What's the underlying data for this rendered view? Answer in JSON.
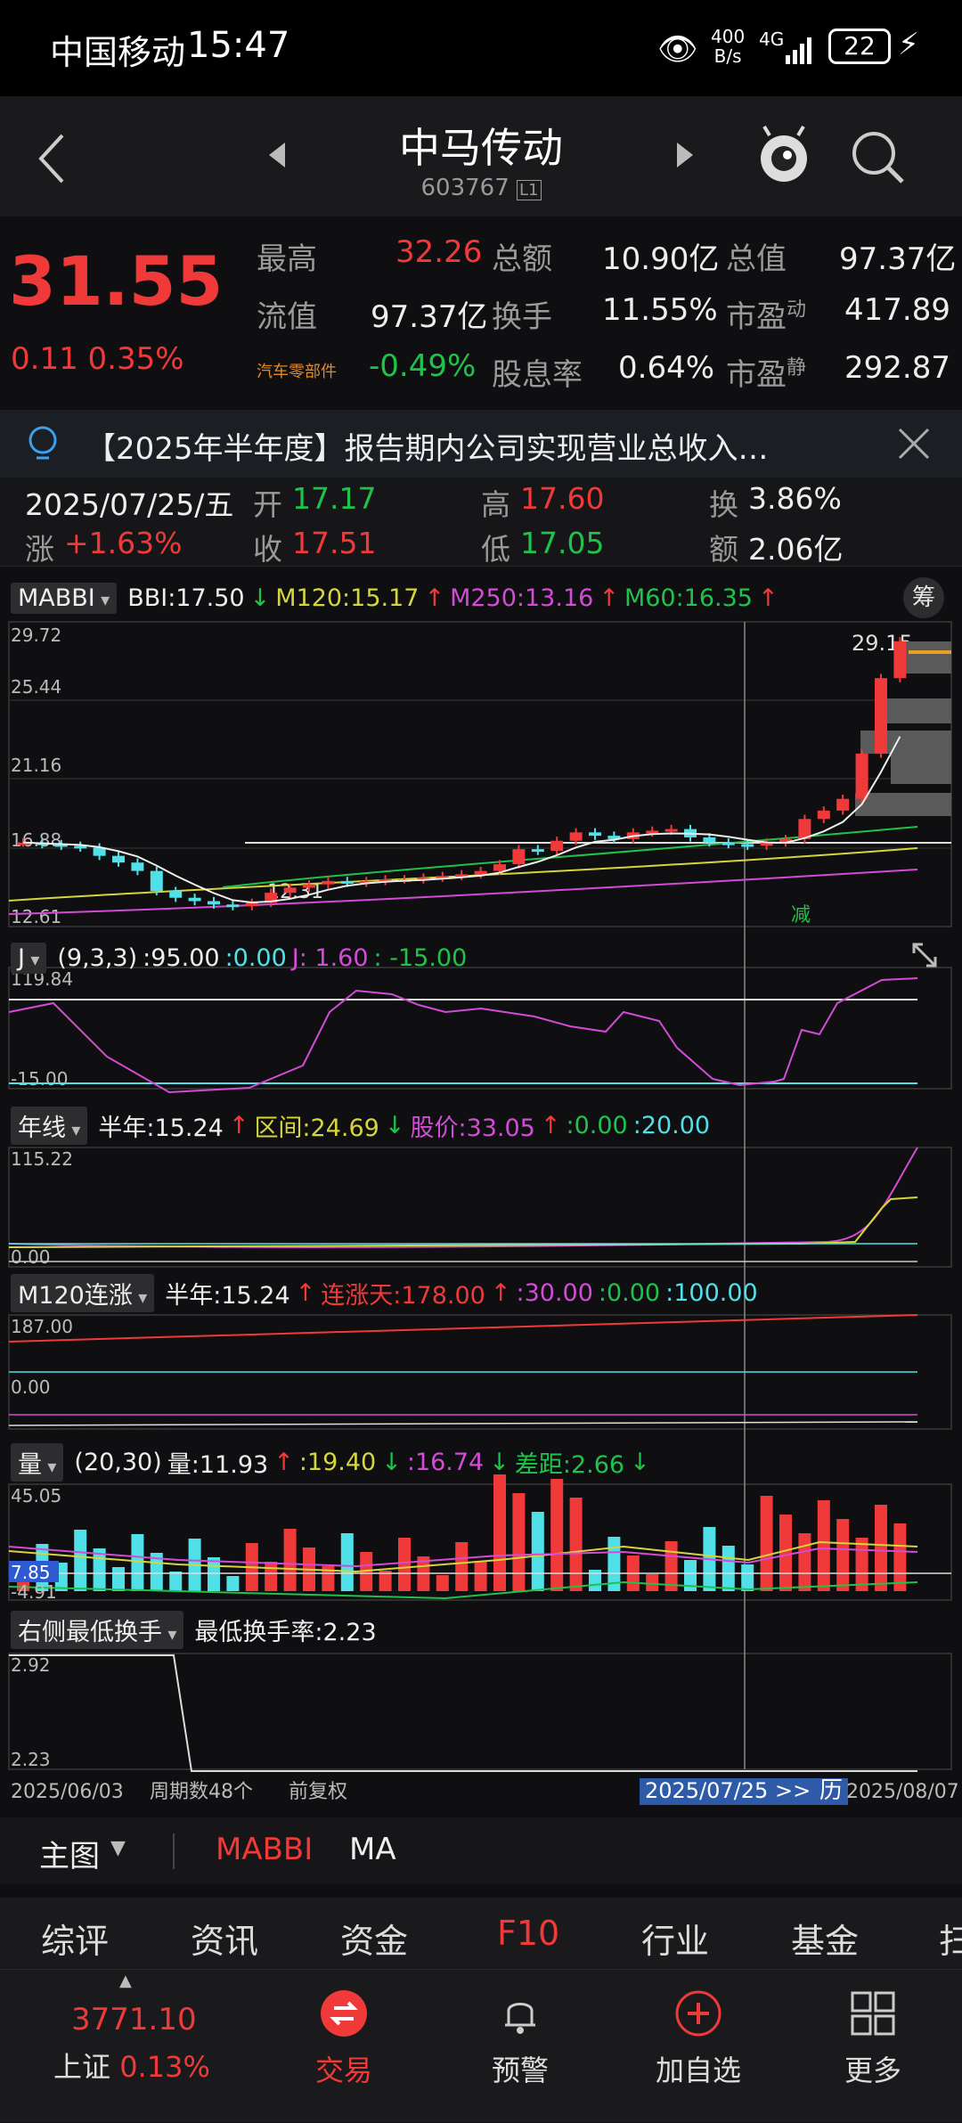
{
  "status_bar": {
    "carrier": "中国移动",
    "time": "15:47",
    "net_speed_top": "400",
    "net_speed_bottom": "B/s",
    "network": "4G",
    "battery": "22"
  },
  "header": {
    "title": "中马传动",
    "code": "603767",
    "level_badge": "L1"
  },
  "quote": {
    "price": "31.55",
    "change": "0.11",
    "change_pct": "0.35%",
    "items": [
      {
        "label": "最高",
        "value": "32.26"
      },
      {
        "label": "总额",
        "value": "10.90亿"
      },
      {
        "label": "总值",
        "value": "97.37亿"
      },
      {
        "label": "流值",
        "value": "97.37亿"
      },
      {
        "label": "换手",
        "value": "11.55%"
      },
      {
        "label": "市盈",
        "sup": "动",
        "value": "417.89"
      },
      {
        "label": "汽车零部件",
        "value": "-0.49%"
      },
      {
        "label": "股息率",
        "value": "0.64%"
      },
      {
        "label": "市盈",
        "sup": "静",
        "value": "292.87"
      }
    ]
  },
  "notice": {
    "text": "【2025年半年度】报告期内公司实现营业总收入…"
  },
  "ohlc": {
    "date": "2025/07/25/五",
    "open_label": "开",
    "open": "17.17",
    "high_label": "高",
    "high": "17.60",
    "turnover_label": "换",
    "turnover": "3.86%",
    "change_label": "涨",
    "change": "+1.63%",
    "close_label": "收",
    "close": "17.51",
    "low_label": "低",
    "low": "17.05",
    "amount_label": "额",
    "amount": "2.06亿"
  },
  "main_chart": {
    "indicator": "MABBI",
    "bbi": "BBI:17.50",
    "m120": "M120:15.17",
    "m250": "M250:13.16",
    "m60": "M60:16.35",
    "side_btn": "筹",
    "y_labels": [
      "29.72",
      "25.44",
      "21.16",
      "16.88",
      "12.61"
    ],
    "high_mark": "29.15",
    "low_mark": "12.31",
    "reduce_mark": "减"
  },
  "chart_data": {
    "type": "candlestick",
    "closes": [
      17.2,
      17.1,
      17.0,
      16.9,
      16.4,
      16.0,
      15.5,
      14.3,
      13.9,
      13.7,
      13.5,
      13.4,
      13.6,
      14.2,
      14.5,
      14.7,
      14.9,
      14.8,
      14.9,
      15.0,
      15.0,
      15.1,
      15.2,
      15.3,
      15.5,
      15.9,
      16.8,
      16.7,
      17.3,
      17.8,
      17.6,
      17.4,
      17.8,
      17.9,
      18.0,
      17.5,
      17.2,
      17.1,
      17.0,
      17.2,
      17.4,
      18.6,
      19.1,
      19.8,
      22.5,
      27.0,
      29.2
    ]
  },
  "ind_j": {
    "name": "J",
    "params": "(9,3,3)",
    "v1": ":95.00",
    "v2": ":0.00",
    "v3": "J: 1.60",
    "v4": ": -15.00",
    "y_top": "119.84",
    "y_bottom": "-15.00"
  },
  "ind_year": {
    "name": "年线",
    "v1": "半年:15.24",
    "v2": "区间:24.69",
    "v3": "股价:33.05",
    "v4": ":0.00",
    "v5": ":20.00",
    "y_top": "115.22",
    "y_bottom": "0.00"
  },
  "ind_m120": {
    "name": "M120连涨",
    "v1": "半年:15.24",
    "v2": "连涨天:178.00",
    "v3": ":30.00",
    "v4": ":0.00",
    "v5": ":100.00",
    "y_top": "187.00",
    "y_bottom": "0.00"
  },
  "ind_vol": {
    "name": "量",
    "params": "(20,30)",
    "v1": "量:11.93",
    "v2": ":19.40",
    "v3": ":16.74",
    "v4": "差距:2.66",
    "y_top": "45.05",
    "y_mid": "7.85",
    "y_bottom": "-4.91"
  },
  "ind_turn": {
    "name": "右侧最低换手",
    "v1": "最低换手率:2.23",
    "y_top": "2.92",
    "y_bottom": "2.23"
  },
  "axis": {
    "left_date": "2025/06/03",
    "period": "周期数48个",
    "adjust": "前复权",
    "cursor_date": "2025/07/25 >>",
    "history": "历",
    "right_date": "2025/08/07"
  },
  "tabs": {
    "main": "主图",
    "t1": "MABBI",
    "t2": "MA"
  },
  "f10": [
    "综评",
    "资讯",
    "资金",
    "F10",
    "行业",
    "基金",
    "扫"
  ],
  "bottom": {
    "index_value": "3771.10",
    "index_name": "上证",
    "index_pct": "0.13%",
    "trade": "交易",
    "alert": "预警",
    "add": "加自选",
    "more": "更多"
  },
  "colors": {
    "up": "#f03a3a",
    "down": "#4fe0e8",
    "bg": "#0f0f11"
  }
}
